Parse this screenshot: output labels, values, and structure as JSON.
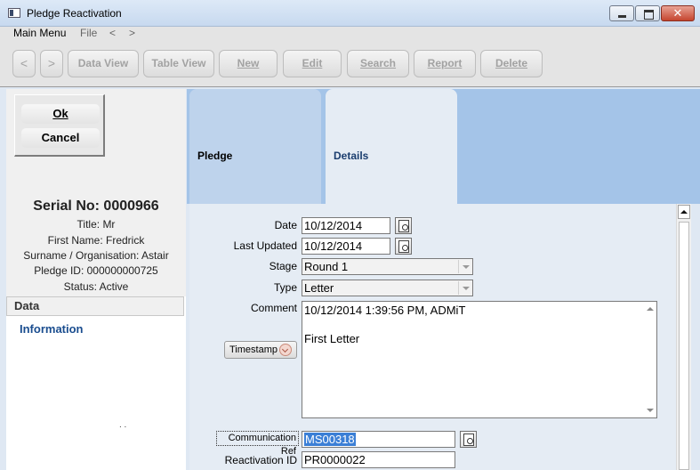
{
  "window": {
    "title": "Pledge Reactivation"
  },
  "menu": {
    "main": "Main Menu",
    "file": "File",
    "back": "<",
    "forward": ">"
  },
  "toolbar": {
    "prev": "<",
    "next": ">",
    "data_view": "Data View",
    "table_view": "Table View",
    "new": "New",
    "edit": "Edit",
    "search": "Search",
    "report": "Report",
    "delete": "Delete"
  },
  "dialog": {
    "ok": "Ok",
    "cancel": "Cancel"
  },
  "record": {
    "serial": "Serial No: 0000966",
    "title": "Title: Mr",
    "first_name": "First Name: Fredrick",
    "surname": "Surname / Organisation: Astair",
    "pledge_id": "Pledge ID: 000000000725",
    "status": "Status: Active"
  },
  "sidebar": {
    "header": "Data",
    "link": "Information",
    "footer_marks": ". ."
  },
  "tabs": [
    {
      "label": "Pledge"
    },
    {
      "label": "Details"
    }
  ],
  "form": {
    "date_label": "Date",
    "date_value": "10/12/2014",
    "last_updated_label": "Last Updated",
    "last_updated_value": "10/12/2014",
    "stage_label": "Stage",
    "stage_value": "Round 1",
    "type_label": "Type",
    "type_value": "Letter",
    "comment_label": "Comment",
    "comment_line1": "10/12/2014 1:39:56 PM, ADMiT",
    "comment_line2": "",
    "comment_line3": "First Letter",
    "timestamp_button": "Timestamp",
    "comm_ref_label": "Communication Ref",
    "comm_ref_value": "MS00318",
    "reactivation_label": "Reactivation ID",
    "reactivation_value": "PR0000022"
  }
}
